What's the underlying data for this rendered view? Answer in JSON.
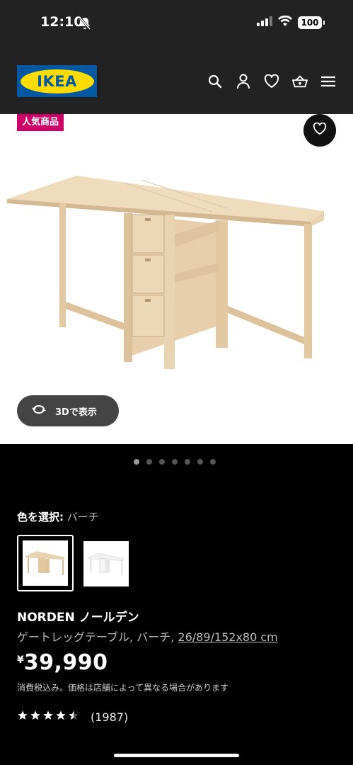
{
  "status": {
    "time": "12:10",
    "battery": "100"
  },
  "header": {
    "logo": "IKEA",
    "icons": [
      "search-icon",
      "account-icon",
      "heart-icon",
      "basket-icon",
      "menu-icon"
    ]
  },
  "hero": {
    "badge": "人気商品",
    "view3d": "3Dで表示",
    "pager": {
      "count": 7,
      "active": 1
    }
  },
  "color": {
    "label": "色を選択:",
    "value": "バーチ"
  },
  "product": {
    "name": "NORDEN ノールデン",
    "desc": "ゲートレッグテーブル, バーチ,",
    "dims": "26/89/152x80 cm",
    "currency": "¥",
    "price": "39,990",
    "tax_note": "消費税込み。価格は店舗によって異なる場合があります",
    "rating": 4.5,
    "reviews": "(1987)"
  },
  "colors": {
    "ikea_blue": "#0058a3",
    "ikea_yellow": "#ffdb00",
    "badge": "#cc0066"
  }
}
